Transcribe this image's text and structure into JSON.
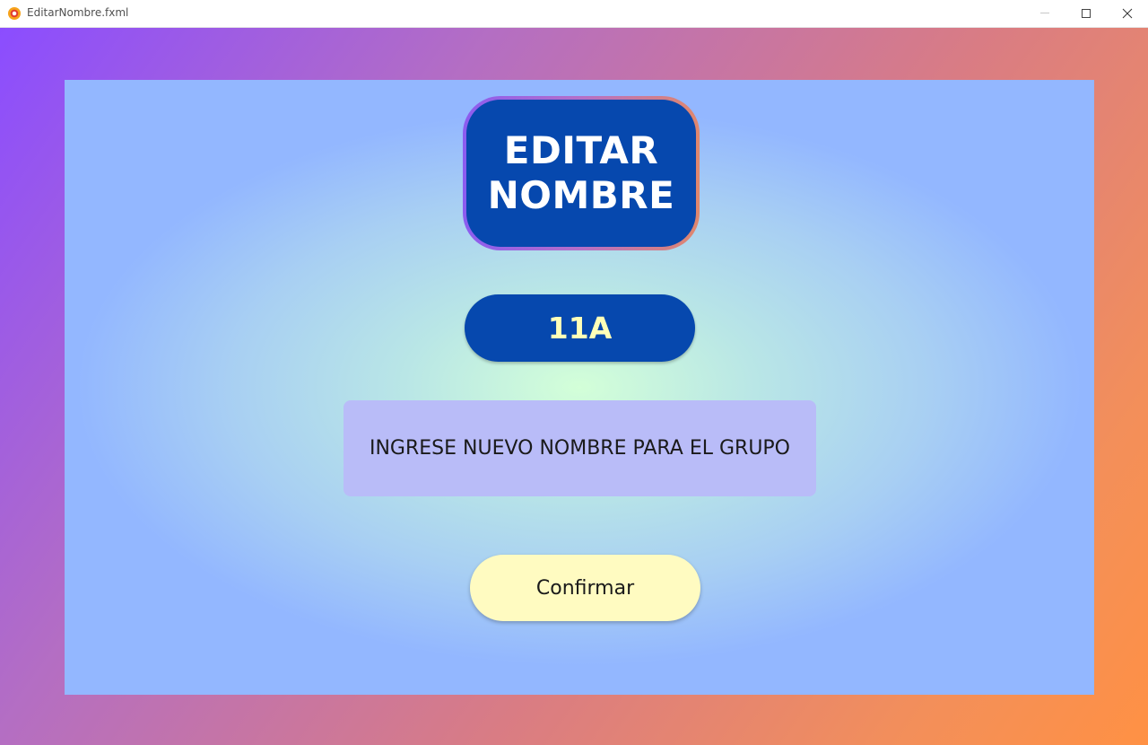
{
  "window": {
    "title": "EditarNombre.fxml",
    "app_icon": "app-logo-icon",
    "controls": {
      "minimize_icon": "minimize-icon",
      "maximize_icon": "maximize-icon",
      "close_icon": "close-icon"
    }
  },
  "heading": {
    "line1": "EDITAR",
    "line2": "NOMBRE"
  },
  "group": {
    "name": "11A"
  },
  "form": {
    "new_name_value": "",
    "new_name_placeholder": "INGRESE NUEVO NOMBRE PARA EL GRUPO"
  },
  "actions": {
    "confirm_label": "Confirmar"
  },
  "colors": {
    "badge_blue": "#0648ae",
    "group_text": "#ffffb8",
    "input_bg": "#b9bcf8",
    "confirm_bg": "#fffbc1"
  }
}
